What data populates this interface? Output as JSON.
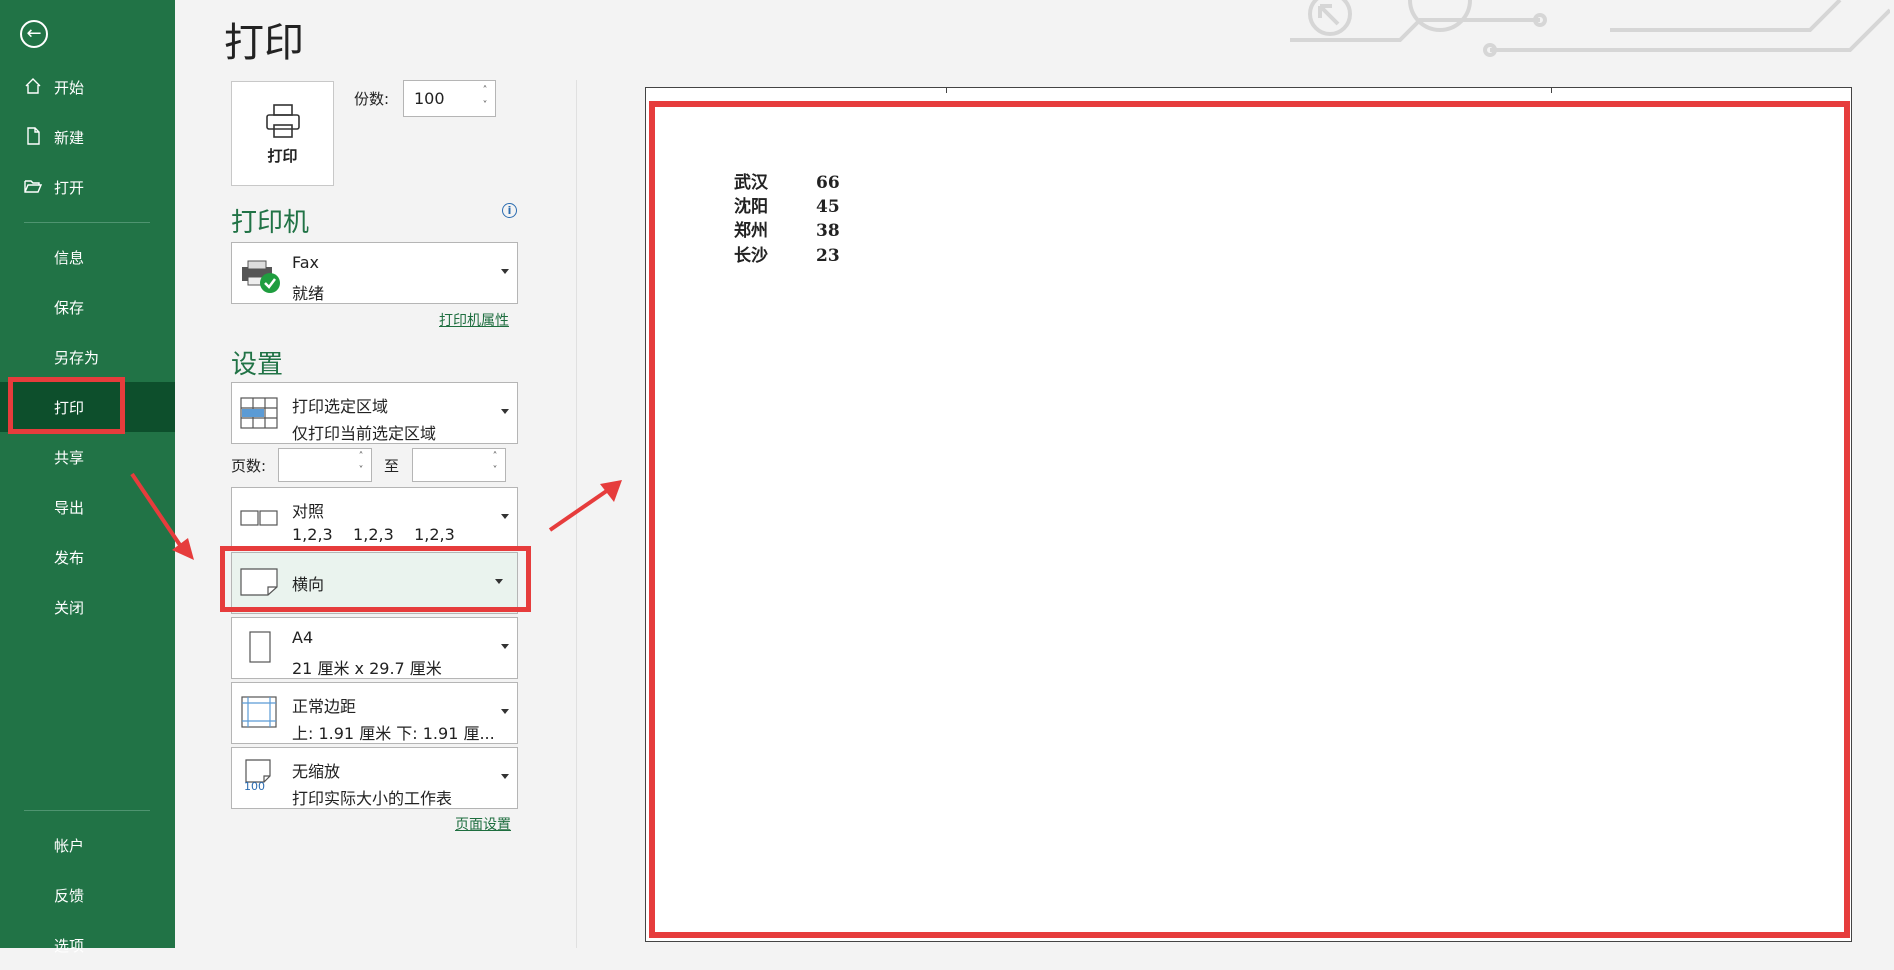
{
  "sidebar": {
    "items": [
      {
        "label": "开始",
        "icon": "home-icon"
      },
      {
        "label": "新建",
        "icon": "new-document-icon"
      },
      {
        "label": "打开",
        "icon": "open-folder-icon"
      },
      {
        "label": "信息"
      },
      {
        "label": "保存"
      },
      {
        "label": "另存为"
      },
      {
        "label": "打印",
        "active": true
      },
      {
        "label": "共享"
      },
      {
        "label": "导出"
      },
      {
        "label": "发布"
      },
      {
        "label": "关闭"
      },
      {
        "label": "帐户"
      },
      {
        "label": "反馈"
      },
      {
        "label": "选项"
      }
    ]
  },
  "page": {
    "title": "打印"
  },
  "print": {
    "button_label": "打印",
    "copies_label": "份数:",
    "copies_value": "100"
  },
  "printer": {
    "section_title": "打印机",
    "name": "Fax",
    "status": "就绪",
    "properties_link": "打印机属性"
  },
  "settings": {
    "section_title": "设置",
    "print_area": {
      "title": "打印选定区域",
      "subtitle": "仅打印当前选定区域"
    },
    "pages_label": "页数:",
    "to_label": "至",
    "collate": {
      "title": "对照",
      "subtitle": "1,2,3    1,2,3    1,2,3"
    },
    "orientation": {
      "title": "横向"
    },
    "paper": {
      "title": "A4",
      "subtitle": "21 厘米 x 29.7 厘米"
    },
    "margins": {
      "title": "正常边距",
      "subtitle": "上: 1.91 厘米 下: 1.91 厘..."
    },
    "scaling": {
      "title": "无缩放",
      "subtitle": "打印实际大小的工作表",
      "icon_text": "100"
    },
    "page_setup_link": "页面设置"
  },
  "preview": {
    "rows": [
      {
        "city": "武汉",
        "value": "66"
      },
      {
        "city": "沈阳",
        "value": "45"
      },
      {
        "city": "郑州",
        "value": "38"
      },
      {
        "city": "长沙",
        "value": "23"
      }
    ]
  },
  "colors": {
    "sidebar": "#217346",
    "active_item": "#0d4f2c",
    "accent": "#217346",
    "annotation": "#e63c3c"
  }
}
